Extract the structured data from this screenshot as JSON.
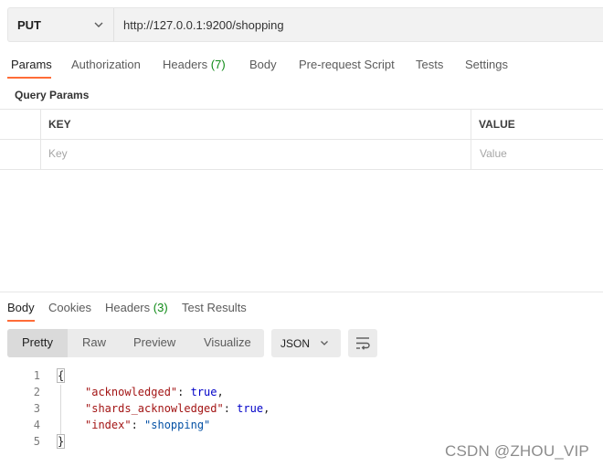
{
  "request": {
    "method": "PUT",
    "url": "http://127.0.0.1:9200/shopping"
  },
  "request_tabs": [
    {
      "label": "Params",
      "count": "",
      "active": true
    },
    {
      "label": "Authorization",
      "count": ""
    },
    {
      "label": "Headers",
      "count": "(7)"
    },
    {
      "label": "Body",
      "count": ""
    },
    {
      "label": "Pre-request Script",
      "count": ""
    },
    {
      "label": "Tests",
      "count": ""
    },
    {
      "label": "Settings",
      "count": ""
    }
  ],
  "params": {
    "title": "Query Params",
    "columns": [
      "KEY",
      "VALUE"
    ],
    "placeholders": {
      "key": "Key",
      "value": "Value"
    }
  },
  "response_tabs": [
    {
      "label": "Body",
      "count": "",
      "active": true
    },
    {
      "label": "Cookies",
      "count": ""
    },
    {
      "label": "Headers",
      "count": "(3)"
    },
    {
      "label": "Test Results",
      "count": ""
    }
  ],
  "view_modes": [
    "Pretty",
    "Raw",
    "Preview",
    "Visualize"
  ],
  "active_view_mode": "Pretty",
  "format": "JSON",
  "code_lines": {
    "numbers": [
      "1",
      "2",
      "3",
      "4",
      "5"
    ],
    "open_brace": "{",
    "close_brace": "}",
    "lines": [
      {
        "key": "\"acknowledged\"",
        "sep": ": ",
        "value": "true",
        "trail": ","
      },
      {
        "key": "\"shards_acknowledged\"",
        "sep": ": ",
        "value": "true",
        "trail": ","
      },
      {
        "key": "\"index\"",
        "sep": ": ",
        "value": "\"shopping\"",
        "trail": ""
      }
    ]
  },
  "watermark": "CSDN @ZHOU_VIP",
  "colors": {
    "accent": "#ff6c37",
    "count": "#0e8a16"
  },
  "icons": [
    "chevron-down-icon",
    "wrap-lines-icon"
  ]
}
